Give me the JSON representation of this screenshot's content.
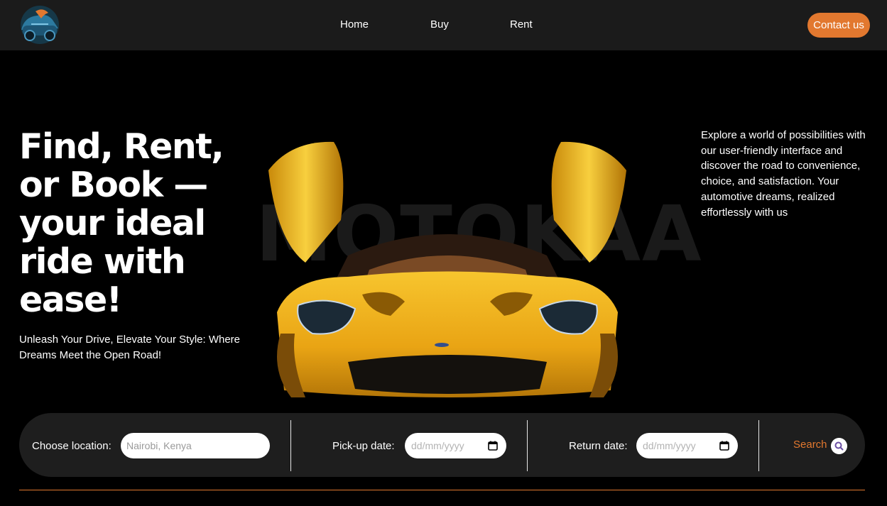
{
  "brand": {
    "logo_icon": "car-mascot-logo"
  },
  "nav": {
    "items": [
      {
        "label": "Home"
      },
      {
        "label": "Buy"
      },
      {
        "label": "Rent"
      }
    ],
    "contact_label": "Contact us"
  },
  "hero": {
    "title": "Find, Rent, or Book — your ideal ride with ease!",
    "subtitle": "Unleash Your Drive, Elevate Your Style: Where Dreams Meet the Open Road!",
    "description": "Explore a world of possibilities with our user-friendly interface and discover the road to convenience, choice, and satisfaction. Your automotive dreams, realized effortlessly with us",
    "watermark": "MOTOKAA"
  },
  "search": {
    "location_label": "Choose location:",
    "location_placeholder": "Nairobi, Kenya",
    "pickup_label": "Pick-up date:",
    "pickup_placeholder": "dd/mm/yyyy",
    "return_label": "Return date:",
    "return_placeholder": "dd/mm/yyyy",
    "button_label": "Search"
  },
  "colors": {
    "accent": "#e2782f",
    "header_bg": "#1b1b1b",
    "page_bg": "#000000",
    "search_bar_bg": "#1e1e1e",
    "car_body": "#f2b01e"
  }
}
